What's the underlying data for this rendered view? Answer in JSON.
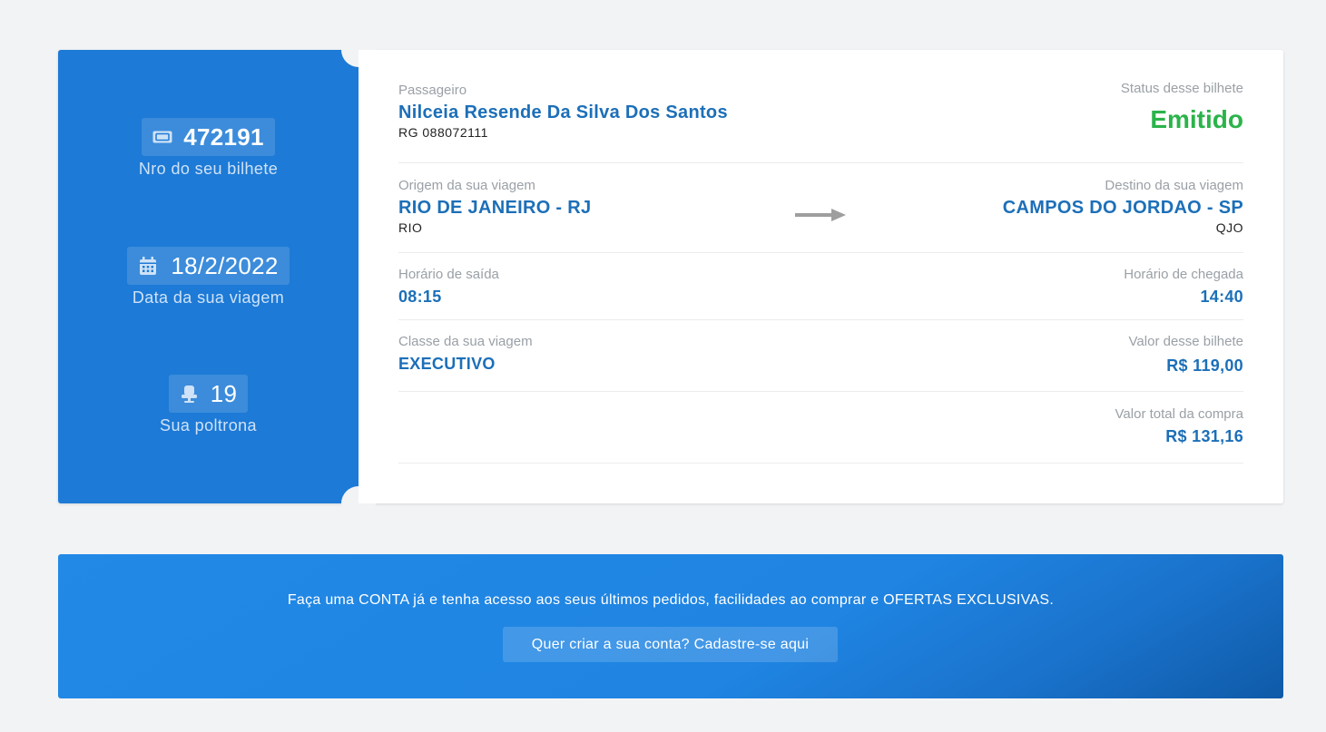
{
  "stub": {
    "ticket_number": "472191",
    "ticket_number_label": "Nro do seu bilhete",
    "trip_date": "18/2/2022",
    "trip_date_label": "Data da sua viagem",
    "seat": "19",
    "seat_label": "Sua poltrona",
    "icons": [
      "ticket-icon",
      "calendar-icon",
      "seat-icon"
    ]
  },
  "passenger": {
    "label": "Passageiro",
    "name": "Nilceia Resende Da Silva Dos Santos",
    "document": "RG 088072111"
  },
  "status": {
    "label": "Status desse bilhete",
    "value": "Emitido",
    "color": "#2bb34a"
  },
  "origin": {
    "label": "Origem da sua viagem",
    "city": "RIO DE JANEIRO - RJ",
    "code": "RIO"
  },
  "destination": {
    "label": "Destino da sua viagem",
    "city": "CAMPOS DO JORDAO - SP",
    "code": "QJO"
  },
  "departure": {
    "label": "Horário de saída",
    "time": "08:15"
  },
  "arrival": {
    "label": "Horário de chegada",
    "time": "14:40"
  },
  "travel_class": {
    "label": "Classe da sua viagem",
    "value": "EXECUTIVO"
  },
  "ticket_price": {
    "label": "Valor desse bilhete",
    "value": "R$ 119,00"
  },
  "total_price": {
    "label": "Valor total da compra",
    "value": "R$ 131,16"
  },
  "promo": {
    "text": "Faça uma CONTA já e tenha acesso aos seus últimos pedidos, facilidades ao comprar e OFERTAS EXCLUSIVAS.",
    "button_label": "Quer criar a sua conta? Cadastre-se aqui"
  },
  "colors": {
    "accent": "#1d7ad6",
    "value_text": "#1c6fb8",
    "status": "#2bb34a",
    "background": "#f2f3f5"
  }
}
